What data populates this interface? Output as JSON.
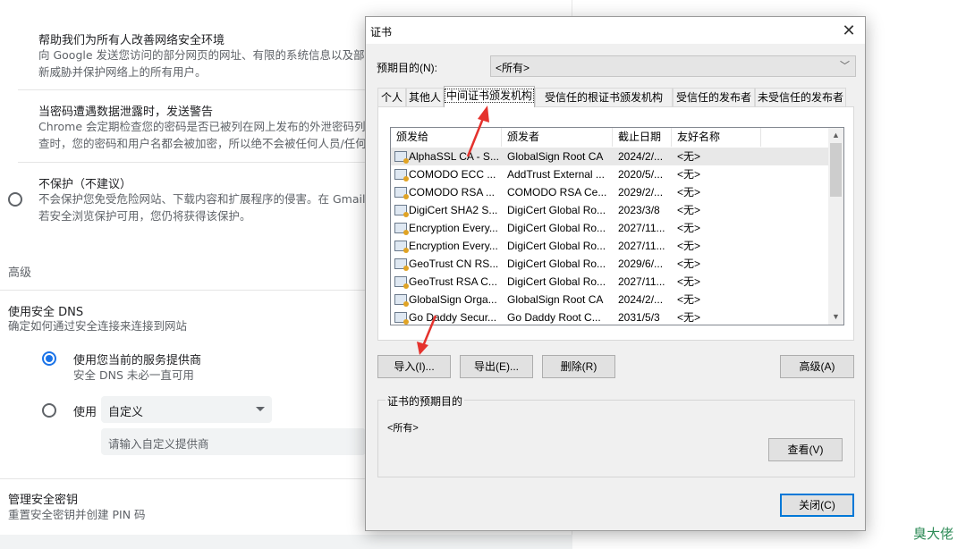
{
  "settings": {
    "help_title": "帮助我们为所有人改善网络安全环境",
    "help_desc_1": "向 Google 发送您访问的部分网页的网址、有限的系统信息以及部分",
    "help_desc_2": "新威胁并保护网络上的所有用户。",
    "pwd_title": "当密码遭遇数据泄露时，发送警告",
    "pwd_desc_1": "Chrome 会定期检查您的密码是否已被列在网上发布的外泄密码列表",
    "pwd_desc_2": "查时，您的密码和用户名都会被加密，所以绝不会被任何人员/任何",
    "noprot_title": "不保护（不建议）",
    "noprot_desc_1": "不会保护您免受危险网站、下载内容和扩展程序的侵害。在 Gmail 和",
    "noprot_desc_2": "若安全浏览保护可用，您仍将获得该保护。",
    "advanced": "高级",
    "dns_title": "使用安全 DNS",
    "dns_desc": "确定如何通过安全连接来连接到网站",
    "dns_current_label": "使用您当前的服务提供商",
    "dns_current_desc": "安全 DNS 未必一直可用",
    "dns_use_label": "使用",
    "dns_custom_value": "自定义",
    "dns_custom_placeholder": "请输入自定义提供商",
    "keys_title": "管理安全密钥",
    "keys_desc": "重置安全密钥并创建 PIN 码"
  },
  "dialog": {
    "title": "证书",
    "close_glyph": "✕",
    "purpose_label": "预期目的(N):",
    "purpose_value": "<所有>",
    "tabs": [
      "个人",
      "其他人",
      "中间证书颁发机构",
      "受信任的根证书颁发机构",
      "受信任的发布者",
      "未受信任的发布者"
    ],
    "columns": [
      "颁发给",
      "颁发者",
      "截止日期",
      "友好名称"
    ],
    "rows": [
      {
        "to": "AlphaSSL CA - S...",
        "by": "GlobalSign Root CA",
        "exp": "2024/2/...",
        "name": "<无>"
      },
      {
        "to": "COMODO ECC ...",
        "by": "AddTrust External ...",
        "exp": "2020/5/...",
        "name": "<无>"
      },
      {
        "to": "COMODO RSA ...",
        "by": "COMODO RSA Ce...",
        "exp": "2029/2/...",
        "name": "<无>"
      },
      {
        "to": "DigiCert SHA2 S...",
        "by": "DigiCert Global Ro...",
        "exp": "2023/3/8",
        "name": "<无>"
      },
      {
        "to": "Encryption Every...",
        "by": "DigiCert Global Ro...",
        "exp": "2027/11...",
        "name": "<无>"
      },
      {
        "to": "Encryption Every...",
        "by": "DigiCert Global Ro...",
        "exp": "2027/11...",
        "name": "<无>"
      },
      {
        "to": "GeoTrust CN RS...",
        "by": "DigiCert Global Ro...",
        "exp": "2029/6/...",
        "name": "<无>"
      },
      {
        "to": "GeoTrust RSA C...",
        "by": "DigiCert Global Ro...",
        "exp": "2027/11...",
        "name": "<无>"
      },
      {
        "to": "GlobalSign Orga...",
        "by": "GlobalSign Root CA",
        "exp": "2024/2/...",
        "name": "<无>"
      },
      {
        "to": "Go Daddy Secur...",
        "by": "Go Daddy Root C...",
        "exp": "2031/5/3",
        "name": "<无>"
      }
    ],
    "import_label": "导入(I)...",
    "export_label": "导出(E)...",
    "remove_label": "删除(R)",
    "advanced_label": "高级(A)",
    "group_label": "证书的预期目的",
    "group_value": "<所有>",
    "view_label": "查看(V)",
    "close_label": "关闭(C)"
  },
  "watermark": "臭大佬",
  "colors": {
    "accent": "#1a73e8",
    "annotation_arrow": "#e5322d",
    "dialog_default_border": "#0078d7"
  }
}
